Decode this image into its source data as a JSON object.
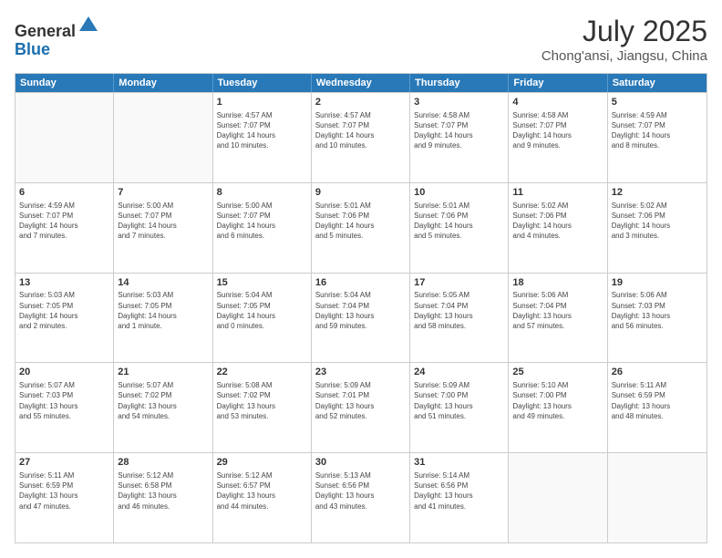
{
  "header": {
    "logo_general": "General",
    "logo_blue": "Blue",
    "title": "July 2025",
    "location": "Chong'ansi, Jiangsu, China"
  },
  "calendar": {
    "days_of_week": [
      "Sunday",
      "Monday",
      "Tuesday",
      "Wednesday",
      "Thursday",
      "Friday",
      "Saturday"
    ],
    "rows": [
      [
        {
          "day": "",
          "detail": ""
        },
        {
          "day": "",
          "detail": ""
        },
        {
          "day": "1",
          "detail": "Sunrise: 4:57 AM\nSunset: 7:07 PM\nDaylight: 14 hours\nand 10 minutes."
        },
        {
          "day": "2",
          "detail": "Sunrise: 4:57 AM\nSunset: 7:07 PM\nDaylight: 14 hours\nand 10 minutes."
        },
        {
          "day": "3",
          "detail": "Sunrise: 4:58 AM\nSunset: 7:07 PM\nDaylight: 14 hours\nand 9 minutes."
        },
        {
          "day": "4",
          "detail": "Sunrise: 4:58 AM\nSunset: 7:07 PM\nDaylight: 14 hours\nand 9 minutes."
        },
        {
          "day": "5",
          "detail": "Sunrise: 4:59 AM\nSunset: 7:07 PM\nDaylight: 14 hours\nand 8 minutes."
        }
      ],
      [
        {
          "day": "6",
          "detail": "Sunrise: 4:59 AM\nSunset: 7:07 PM\nDaylight: 14 hours\nand 7 minutes."
        },
        {
          "day": "7",
          "detail": "Sunrise: 5:00 AM\nSunset: 7:07 PM\nDaylight: 14 hours\nand 7 minutes."
        },
        {
          "day": "8",
          "detail": "Sunrise: 5:00 AM\nSunset: 7:07 PM\nDaylight: 14 hours\nand 6 minutes."
        },
        {
          "day": "9",
          "detail": "Sunrise: 5:01 AM\nSunset: 7:06 PM\nDaylight: 14 hours\nand 5 minutes."
        },
        {
          "day": "10",
          "detail": "Sunrise: 5:01 AM\nSunset: 7:06 PM\nDaylight: 14 hours\nand 5 minutes."
        },
        {
          "day": "11",
          "detail": "Sunrise: 5:02 AM\nSunset: 7:06 PM\nDaylight: 14 hours\nand 4 minutes."
        },
        {
          "day": "12",
          "detail": "Sunrise: 5:02 AM\nSunset: 7:06 PM\nDaylight: 14 hours\nand 3 minutes."
        }
      ],
      [
        {
          "day": "13",
          "detail": "Sunrise: 5:03 AM\nSunset: 7:05 PM\nDaylight: 14 hours\nand 2 minutes."
        },
        {
          "day": "14",
          "detail": "Sunrise: 5:03 AM\nSunset: 7:05 PM\nDaylight: 14 hours\nand 1 minute."
        },
        {
          "day": "15",
          "detail": "Sunrise: 5:04 AM\nSunset: 7:05 PM\nDaylight: 14 hours\nand 0 minutes."
        },
        {
          "day": "16",
          "detail": "Sunrise: 5:04 AM\nSunset: 7:04 PM\nDaylight: 13 hours\nand 59 minutes."
        },
        {
          "day": "17",
          "detail": "Sunrise: 5:05 AM\nSunset: 7:04 PM\nDaylight: 13 hours\nand 58 minutes."
        },
        {
          "day": "18",
          "detail": "Sunrise: 5:06 AM\nSunset: 7:04 PM\nDaylight: 13 hours\nand 57 minutes."
        },
        {
          "day": "19",
          "detail": "Sunrise: 5:06 AM\nSunset: 7:03 PM\nDaylight: 13 hours\nand 56 minutes."
        }
      ],
      [
        {
          "day": "20",
          "detail": "Sunrise: 5:07 AM\nSunset: 7:03 PM\nDaylight: 13 hours\nand 55 minutes."
        },
        {
          "day": "21",
          "detail": "Sunrise: 5:07 AM\nSunset: 7:02 PM\nDaylight: 13 hours\nand 54 minutes."
        },
        {
          "day": "22",
          "detail": "Sunrise: 5:08 AM\nSunset: 7:02 PM\nDaylight: 13 hours\nand 53 minutes."
        },
        {
          "day": "23",
          "detail": "Sunrise: 5:09 AM\nSunset: 7:01 PM\nDaylight: 13 hours\nand 52 minutes."
        },
        {
          "day": "24",
          "detail": "Sunrise: 5:09 AM\nSunset: 7:00 PM\nDaylight: 13 hours\nand 51 minutes."
        },
        {
          "day": "25",
          "detail": "Sunrise: 5:10 AM\nSunset: 7:00 PM\nDaylight: 13 hours\nand 49 minutes."
        },
        {
          "day": "26",
          "detail": "Sunrise: 5:11 AM\nSunset: 6:59 PM\nDaylight: 13 hours\nand 48 minutes."
        }
      ],
      [
        {
          "day": "27",
          "detail": "Sunrise: 5:11 AM\nSunset: 6:59 PM\nDaylight: 13 hours\nand 47 minutes."
        },
        {
          "day": "28",
          "detail": "Sunrise: 5:12 AM\nSunset: 6:58 PM\nDaylight: 13 hours\nand 46 minutes."
        },
        {
          "day": "29",
          "detail": "Sunrise: 5:12 AM\nSunset: 6:57 PM\nDaylight: 13 hours\nand 44 minutes."
        },
        {
          "day": "30",
          "detail": "Sunrise: 5:13 AM\nSunset: 6:56 PM\nDaylight: 13 hours\nand 43 minutes."
        },
        {
          "day": "31",
          "detail": "Sunrise: 5:14 AM\nSunset: 6:56 PM\nDaylight: 13 hours\nand 41 minutes."
        },
        {
          "day": "",
          "detail": ""
        },
        {
          "day": "",
          "detail": ""
        }
      ]
    ]
  }
}
